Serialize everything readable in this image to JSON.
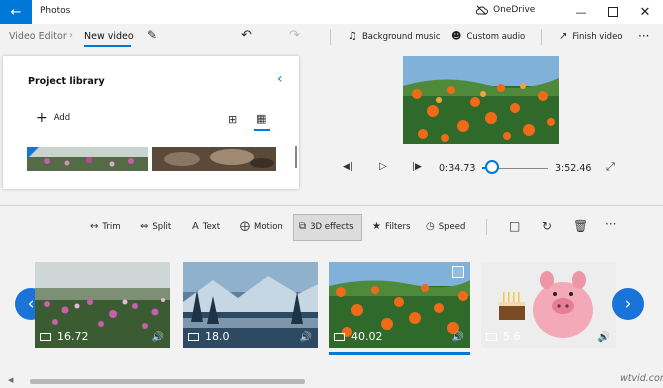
{
  "app": {
    "title": "Photos",
    "cloud_label": "OneDrive"
  },
  "breadcrumb": {
    "root": "Video Editor",
    "separator": "›",
    "current": "New video"
  },
  "toolbar": {
    "background_music": "Background music",
    "custom_audio": "Custom audio",
    "finish_video": "Finish video",
    "more": "···"
  },
  "library": {
    "title": "Project library",
    "add_label": "Add"
  },
  "player": {
    "current_time": "0:34.73",
    "total_time": "3:52.46",
    "progress": 0.149
  },
  "storyboard_tools": {
    "trim": "Trim",
    "split": "Split",
    "text": "Text",
    "motion": "Motion",
    "effects_3d": "3D effects",
    "filters": "Filters",
    "speed": "Speed",
    "more": "···"
  },
  "clips": [
    {
      "duration": "16.72",
      "selected": false
    },
    {
      "duration": "18.0",
      "selected": false
    },
    {
      "duration": "40.02",
      "selected": true
    },
    {
      "duration": "5.6",
      "selected": false
    }
  ],
  "watermark": "wtvid.com",
  "colors": {
    "accent": "#0078d7",
    "nav_button": "#1a73d9"
  },
  "icons": {
    "back": "arrow-left-icon",
    "cloud": "cloud-icon",
    "rename": "pencil-icon",
    "undo": "undo-icon",
    "redo": "redo-icon"
  }
}
